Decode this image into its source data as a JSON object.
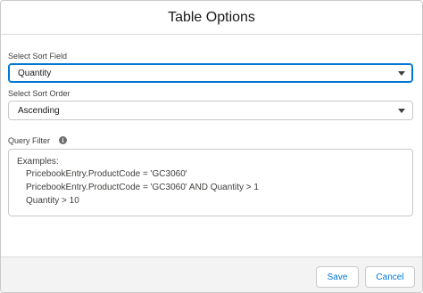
{
  "modal": {
    "title": "Table Options"
  },
  "sort_field": {
    "label": "Select Sort Field",
    "value": "Quantity"
  },
  "sort_order": {
    "label": "Select Sort Order",
    "value": "Ascending"
  },
  "query_filter": {
    "label": "Query Filter",
    "info_icon": "info-icon",
    "placeholder_lines": [
      "Examples:",
      "PricebookEntry.ProductCode = 'GC3060'",
      "PricebookEntry.ProductCode = 'GC3060' AND Quantity > 1",
      "Quantity > 10"
    ]
  },
  "footer": {
    "save_label": "Save",
    "cancel_label": "Cancel"
  },
  "colors": {
    "accent": "#0176d3",
    "footer_bg": "#f3f3f3",
    "border": "#c9c9c9"
  }
}
